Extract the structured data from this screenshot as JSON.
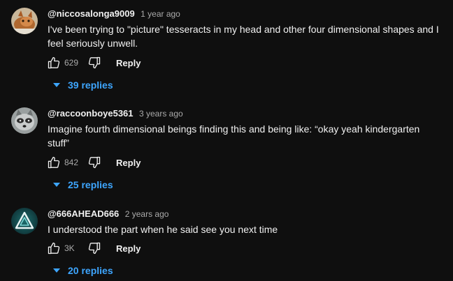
{
  "colors": {
    "background": "#0f0f0f",
    "text": "#f1f1f1",
    "secondary_text": "#aaaaaa",
    "link": "#3ea6ff"
  },
  "comments": [
    {
      "handle": "@niccosalonga9009",
      "time": "1 year ago",
      "text": "I've been trying to \"picture\" tesseracts in my head and other four dimensional shapes and I feel seriously unwell.",
      "likes": "629",
      "reply_label": "Reply",
      "replies_label": "39 replies",
      "avatar_icon": "cat-avatar"
    },
    {
      "handle": "@raccoonboye5361",
      "time": "3 years ago",
      "text": "Imagine fourth dimensional beings finding this and being like: “okay yeah kindergarten stuff”",
      "likes": "842",
      "reply_label": "Reply",
      "replies_label": "25 replies",
      "avatar_icon": "raccoon-avatar"
    },
    {
      "handle": "@666AHEAD666",
      "time": "2 years ago",
      "text": "I understood the part when he said see you next time",
      "likes": "3K",
      "reply_label": "Reply",
      "replies_label": "20 replies",
      "avatar_icon": "triangle-logo-avatar"
    }
  ]
}
